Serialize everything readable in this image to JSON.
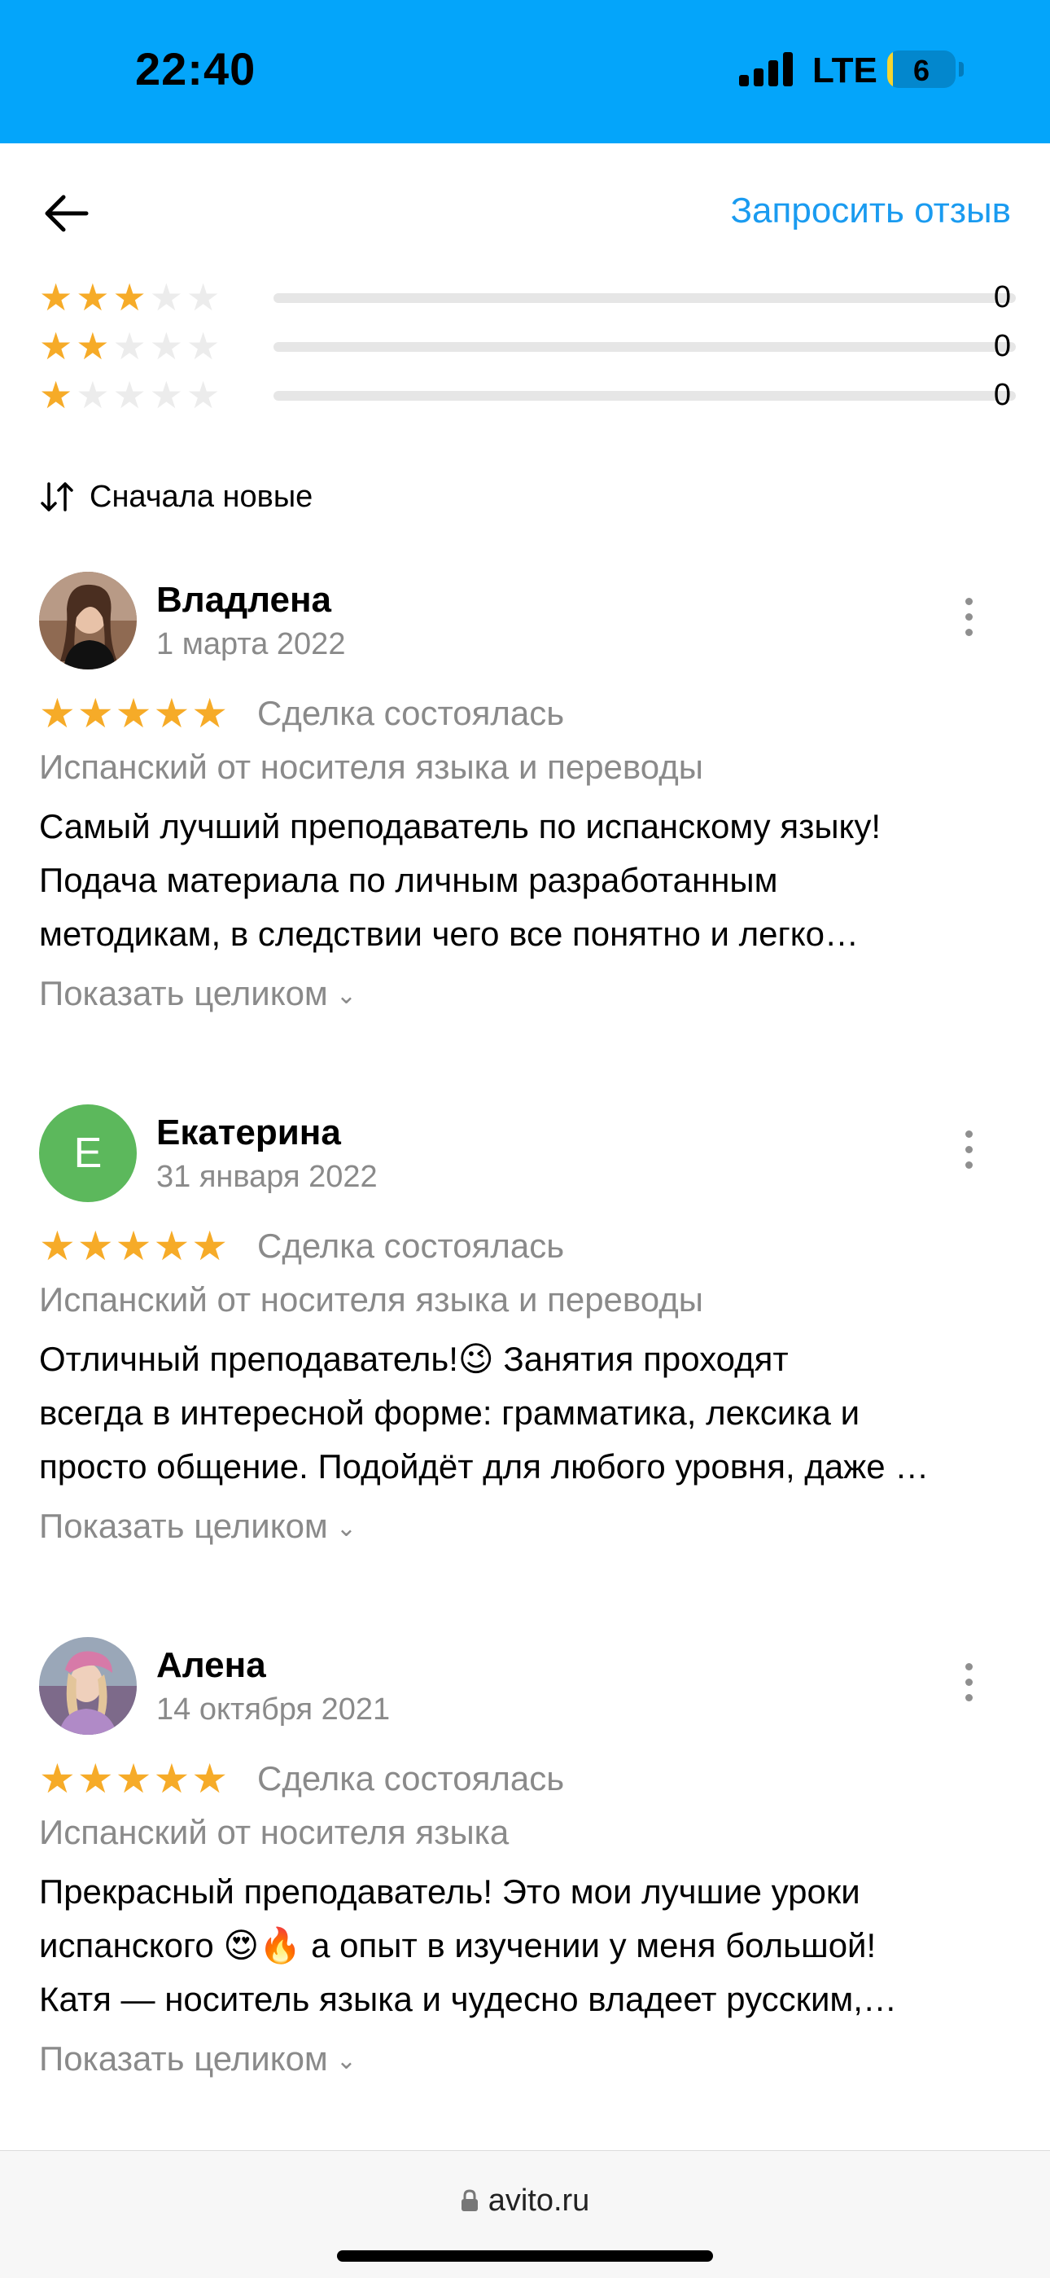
{
  "status_bar": {
    "time": "22:40",
    "network": "LTE",
    "battery": "6",
    "battery_level": 0.06,
    "background": "#04a5fa"
  },
  "header": {
    "back_icon": "arrow-left-icon",
    "request_review": "Запросить отзыв"
  },
  "rating_breakdown": [
    {
      "stars": 3,
      "count": "0"
    },
    {
      "stars": 2,
      "count": "0"
    },
    {
      "stars": 1,
      "count": "0"
    }
  ],
  "sort": {
    "icon": "sort-arrows-icon",
    "label": "Сначала новые"
  },
  "reviews": [
    {
      "name": "Владлена",
      "date": "1 марта 2022",
      "stars": "★★★★★",
      "deal": "Сделка состоялась",
      "service": "Испанский от носителя языка и переводы",
      "lines": [
        "Самый лучший преподаватель по испанскому языку!",
        "Подача материала по личным разработанным",
        "методикам, в следствии чего все понятно и легко…"
      ],
      "show_full": "Показать целиком",
      "avatar": "photo"
    },
    {
      "name": "Екатерина",
      "date": "31 января 2022",
      "stars": "★★★★★",
      "deal": "Сделка состоялась",
      "service": "Испанский от носителя языка и переводы",
      "lines": [
        "Отличный преподаватель!😉 Занятия проходят",
        "всегда в интересной форме: грамматика, лексика и",
        "просто общение. Подойдёт для любого уровня, даже …"
      ],
      "show_full": "Показать целиком",
      "avatar": "E",
      "avatar_color": "#5cb85c"
    },
    {
      "name": "Алена",
      "date": "14 октября 2021",
      "stars": "★★★★★",
      "deal": "Сделка состоялась",
      "service": "Испанский от носителя языка",
      "lines": [
        "Прекрасный преподаватель! Это мои лучшие уроки",
        "испанского 😍🔥 а опыт в изучении у меня большой!",
        "Катя — носитель языка и чудесно владеет русским,…"
      ],
      "show_full": "Показать целиком",
      "avatar": "photo"
    }
  ],
  "browser": {
    "lock_icon": "lock-icon",
    "url": "avito.ru"
  },
  "colors": {
    "accent": "#1a9bf0",
    "star": "#f6ab28",
    "muted": "#8a8a8a"
  }
}
